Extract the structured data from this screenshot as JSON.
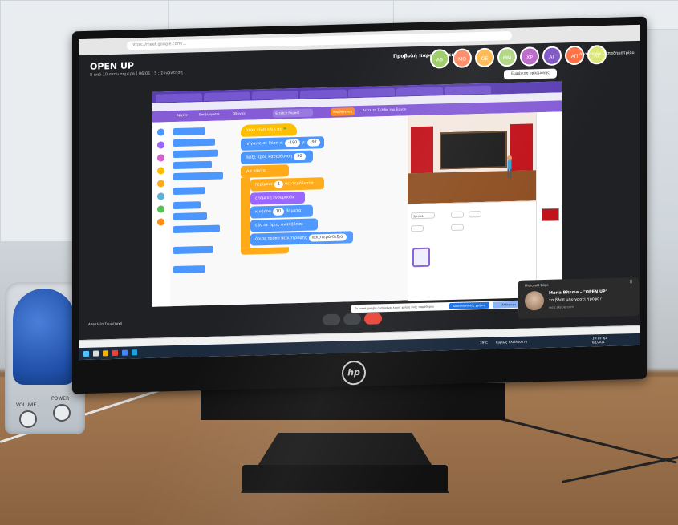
{
  "browser": {
    "url": "https://meet.google.com/..."
  },
  "meet": {
    "title": "OPEN UP",
    "subtitle": "8 από 10 στην σήμερα | 06:01 | 5 : Συνάντηση",
    "present_label": "Προβολή παρουσιάσεων",
    "tooltip": "Εμφάνιση εφαρμογής",
    "user_name": "Αναστασία Παπαδημητρίου",
    "participants": [
      {
        "initials": "AB",
        "color": "#9ccc65"
      },
      {
        "initials": "MO",
        "color": "#ff8a65"
      },
      {
        "initials": "OE",
        "color": "#ffb74d"
      },
      {
        "initials": "MM",
        "color": "#aed581"
      },
      {
        "initials": "ΧΡ",
        "color": "#ba68c8"
      },
      {
        "initials": "ΑΓ",
        "color": "#7e57c2"
      },
      {
        "initials": "ΑΠ",
        "color": "#ff7043"
      },
      {
        "initials": "ΑΣ",
        "color": "#dce775"
      }
    ],
    "bottom_left": "Ασφαλεία  Συμμετοχή"
  },
  "scratch": {
    "save_label": "Αποθήκευση",
    "project_name": "Scratch Project",
    "menu": [
      "Αρχείο",
      "Επεξεργασία",
      "Οδηγίες"
    ],
    "share_link": "Δείτε τη Σελίδα του Έργου",
    "script_blocks": {
      "hat": "όταν γίνει κλικ σε",
      "goto": "πήγαινε σε θέση x:",
      "goto_x": "-180",
      "goto_y": "-97",
      "point": "δείξε προς κατεύθυνση",
      "point_val": "90",
      "forever": "για πάντα",
      "wait": "περίμενε",
      "wait_val": "1",
      "wait_unit": "δευτερόλεπτα",
      "next_costume": "επόμενη ενδυμασία",
      "move": "κινήσου",
      "move_val": "10",
      "move_unit": "βήματα",
      "bounce": "εάν σε όριο, αναπήδησε",
      "rotation": "όρισε τρόπο περιστροφής",
      "rotation_val": "αριστερά-δεξιά"
    },
    "sprite_name": "Sprite1"
  },
  "notification": {
    "app": "Microsoft Edge",
    "name": "Maria Bitsma – \"OPEN UP\"",
    "message": "τα βλεπ μην γροτί τρόφο?",
    "source": "web.skype.com"
  },
  "sharing_bar": {
    "text": "Το meet.google.com κάνει κοινή χρήση ενός παραθύρου",
    "stop": "Διακοπή κοινής χρήσης",
    "hide": "Απόκρυψη"
  },
  "taskbar": {
    "temperature": "19°C",
    "weather": "Κυρίως ηλιόλουστο",
    "time": "10:15 πμ",
    "date": "6/1/2021"
  },
  "monitor": {
    "brand": "hp"
  },
  "speaker": {
    "volume": "VOLUME",
    "power": "POWER"
  }
}
